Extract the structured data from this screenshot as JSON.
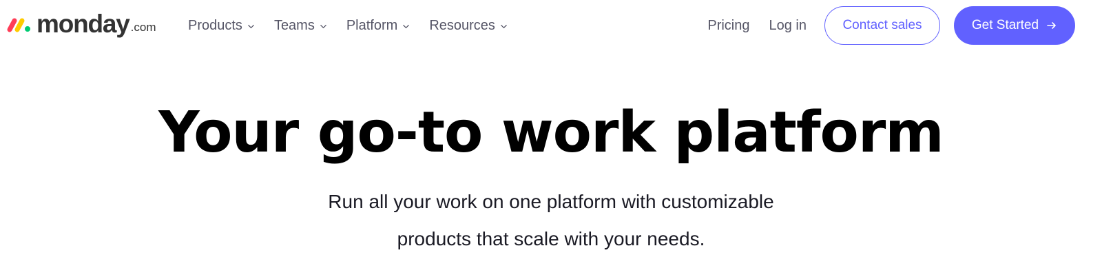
{
  "header": {
    "logo": {
      "word": "monday",
      "tld": ".com",
      "mark_colors": [
        "#ff3d57",
        "#ffcb00",
        "#00ca72"
      ]
    },
    "nav": [
      {
        "label": "Products",
        "icon": "chevron-down-icon"
      },
      {
        "label": "Teams",
        "icon": "chevron-down-icon"
      },
      {
        "label": "Platform",
        "icon": "chevron-down-icon"
      },
      {
        "label": "Resources",
        "icon": "chevron-down-icon"
      }
    ],
    "pricing": "Pricing",
    "login": "Log in",
    "contact_sales": "Contact sales",
    "get_started": "Get Started",
    "get_started_icon": "arrow-right-icon"
  },
  "hero": {
    "title": "Your go-to work platform",
    "subtitle_line1": "Run all your work on one platform with customizable",
    "subtitle_line2": "products that scale with your needs."
  },
  "colors": {
    "accent": "#6161ff",
    "nav_text": "#555566",
    "heading": "#000000",
    "background": "#ffffff"
  }
}
